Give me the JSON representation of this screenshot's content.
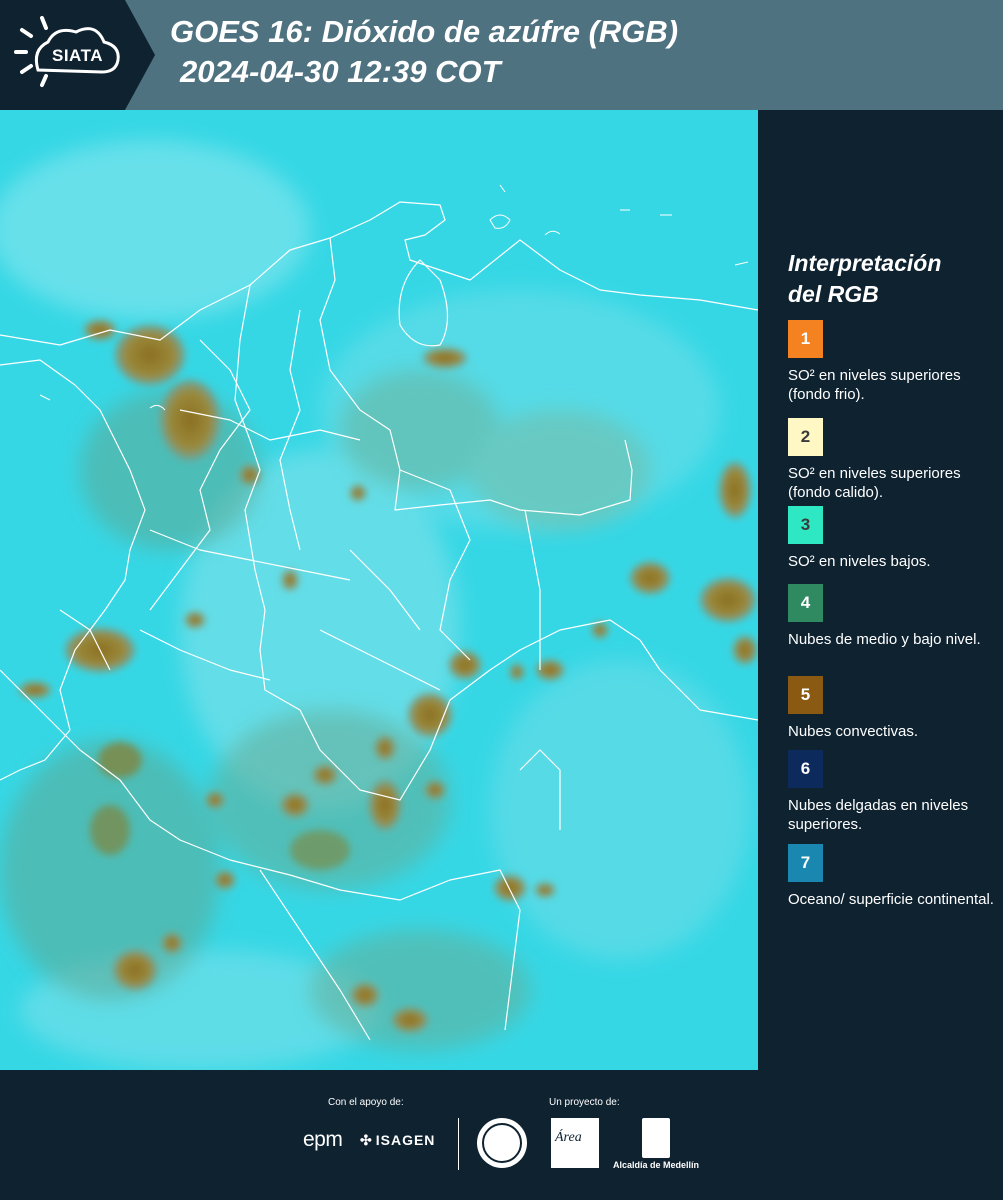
{
  "header": {
    "logo_text": "SIATA",
    "title_line1": "GOES 16: Dióxido de azúfre (RGB)",
    "title_line2": "2024-04-30 12:39 COT",
    "background_color": "#4e7280",
    "logo_color": "#0e2230"
  },
  "map": {
    "product": "GOES 16 Sulfur Dioxide RGB",
    "background_color": "#34d6e4",
    "convective_cloud_color": "#8a7a2e",
    "boundary_color": "#ffffff"
  },
  "legend": {
    "title_line1": "Interpretación",
    "title_line2": "del RGB",
    "items": [
      {
        "number": "1",
        "color": "#f58220",
        "text_color": "#ffffff",
        "text": "SO² en niveles superiores (fondo frio)."
      },
      {
        "number": "2",
        "color": "#fff8c4",
        "text_color": "#3a3a3a",
        "text": "SO² en niveles superiores (fondo calido)."
      },
      {
        "number": "3",
        "color": "#2ee8c4",
        "text_color": "#3a3a3a",
        "text": "SO² en niveles bajos."
      },
      {
        "number": "4",
        "color": "#2f8a62",
        "text_color": "#ffffff",
        "text": "Nubes de medio y bajo nivel."
      },
      {
        "number": "5",
        "color": "#8a5a12",
        "text_color": "#ffffff",
        "text": "Nubes convectivas."
      },
      {
        "number": "6",
        "color": "#0d2a5c",
        "text_color": "#ffffff",
        "text": "Nubes delgadas en niveles superiores."
      },
      {
        "number": "7",
        "color": "#1a87b0",
        "text_color": "#ffffff",
        "text": "Oceano/ superficie continental."
      }
    ]
  },
  "footer": {
    "support_label": "Con el apoyo de:",
    "project_label": "Un proyecto de:",
    "sponsor_1": "epm",
    "sponsor_2": "ISAGEN",
    "partner_1": "Área",
    "partner_2": "Alcaldía de Medellín"
  }
}
